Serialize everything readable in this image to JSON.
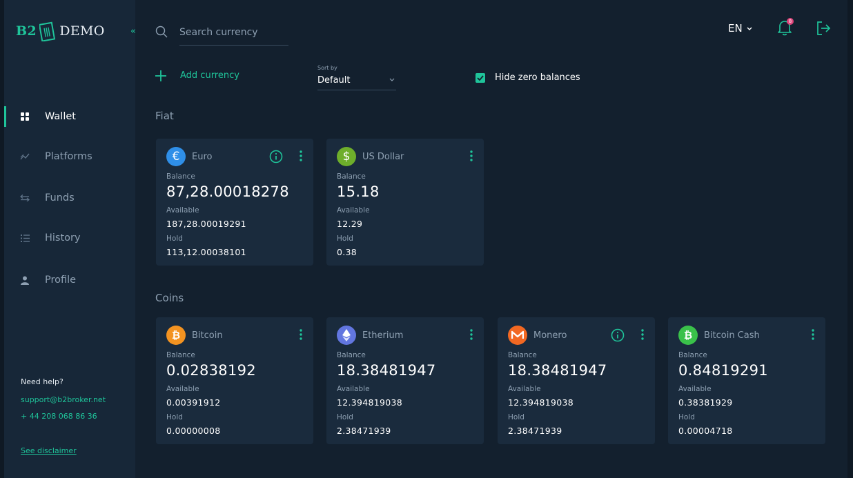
{
  "brand": {
    "b2": "B2",
    "demo": "DEMO"
  },
  "sidebar": {
    "items": [
      {
        "label": "Wallet",
        "icon": "grid-icon",
        "active": true
      },
      {
        "label": "Platforms",
        "icon": "chart-line-icon"
      },
      {
        "label": "Funds",
        "icon": "transfer-icon"
      },
      {
        "label": "History",
        "icon": "list-icon"
      },
      {
        "label": "Profile",
        "icon": "user-icon"
      }
    ],
    "help_title": "Need help?",
    "help_email": "support@b2broker.net",
    "help_phone": "+ 44 208 068 86 36",
    "disclaimer": "See disclaimer"
  },
  "header": {
    "search_placeholder": "Search currency",
    "language": "EN",
    "notification_count": "8"
  },
  "controls": {
    "add_currency": "Add currency",
    "sort_label": "Sort by",
    "sort_value": "Default",
    "hide_zero": "Hide zero balances",
    "hide_zero_checked": true
  },
  "labels": {
    "balance": "Balance",
    "available": "Available",
    "hold": "Hold"
  },
  "sections": {
    "fiat": {
      "title": "Fiat",
      "cards": [
        {
          "name": "Euro",
          "symbol": "€",
          "color": "#2f8fe8",
          "balance": "87,28.00018278",
          "available": "187,28.00019291",
          "hold": "113,12.00038101",
          "has_info": true
        },
        {
          "name": "US Dollar",
          "symbol": "$",
          "color": "#6eae2b",
          "balance": "15.18",
          "available": "12.29",
          "hold": "0.38",
          "has_info": false
        }
      ]
    },
    "coins": {
      "title": "Coins",
      "cards": [
        {
          "name": "Bitcoin",
          "symbol": "₿",
          "color": "#f39321",
          "balance": "0.02838192",
          "available": "0.00391912",
          "hold": "0.00000008",
          "has_info": false
        },
        {
          "name": "Etherium",
          "symbol": "◆",
          "color": "#6276e0",
          "balance": "18.38481947",
          "available": "12.394819038",
          "hold": "2.38471939",
          "has_info": false
        },
        {
          "name": "Monero",
          "symbol": "M",
          "color": "#f26822",
          "balance": "18.38481947",
          "available": "12.394819038",
          "hold": "2.38471939",
          "has_info": true
        },
        {
          "name": "Bitcoin Cash",
          "symbol": "₿",
          "color": "#3ac14a",
          "balance": "0.84819291",
          "available": "0.38381929",
          "hold": "0.00004718",
          "has_info": false
        }
      ]
    }
  }
}
